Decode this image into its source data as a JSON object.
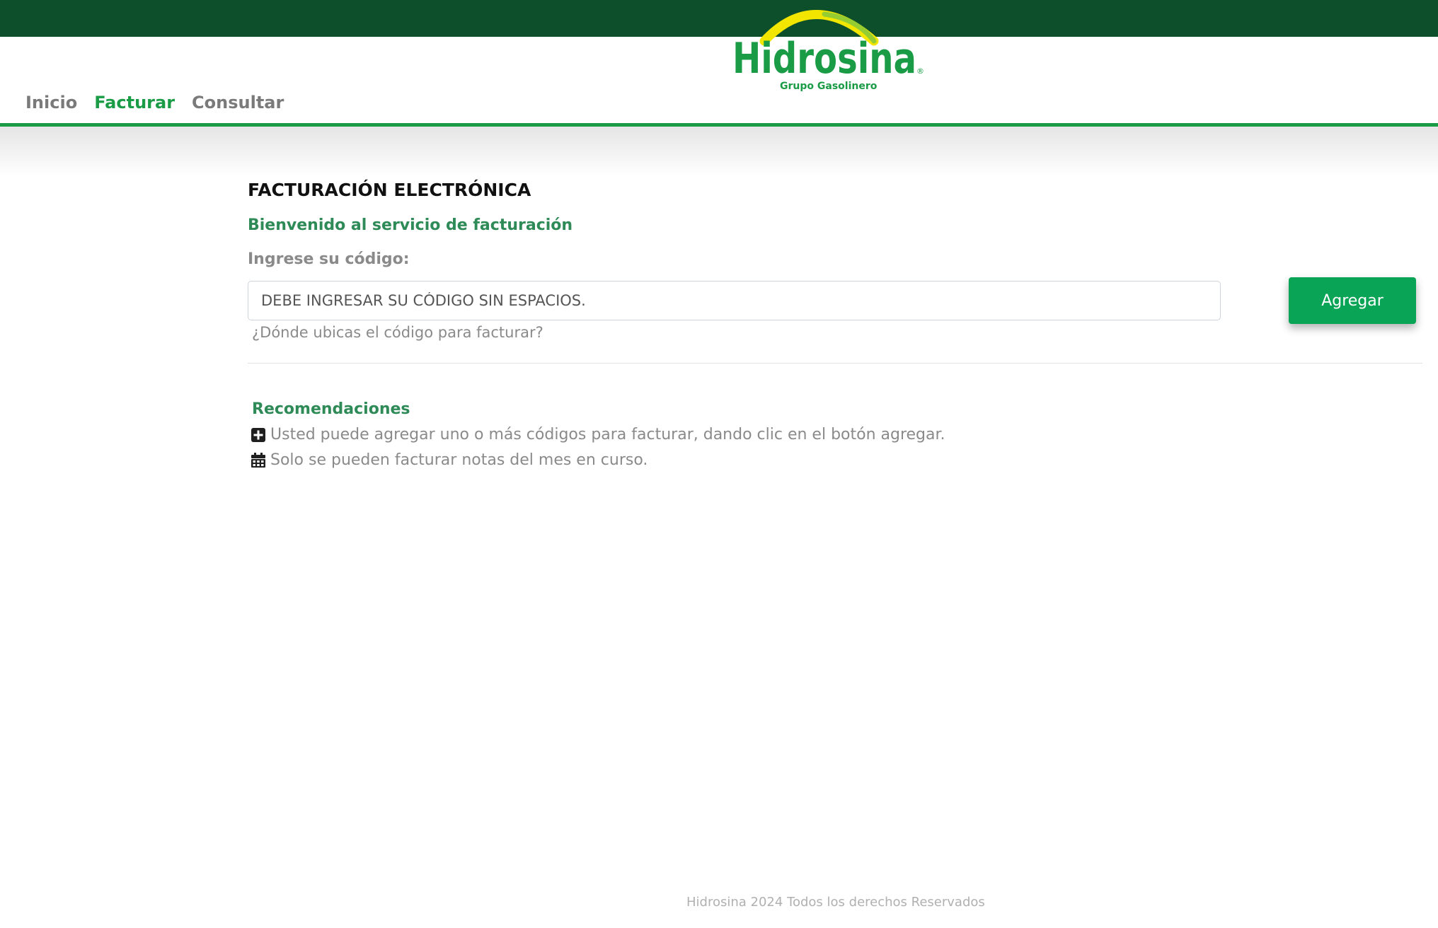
{
  "brand": {
    "name": "Hidrosina",
    "tagline": "Grupo Gasolinero",
    "registered_mark": "®"
  },
  "colors": {
    "top_bar": "#0c4f2a",
    "accent_green": "#1a9b45",
    "button_green": "#0aa456",
    "logo_yellow": "#f2e600"
  },
  "nav": {
    "items": [
      {
        "label": "Inicio",
        "active": false
      },
      {
        "label": "Facturar",
        "active": true
      },
      {
        "label": "Consultar",
        "active": false
      }
    ]
  },
  "main": {
    "title": "FACTURACIÓN ELECTRÓNICA",
    "welcome": "Bienvenido al servicio de facturación",
    "code_label": "Ingrese su código:",
    "code_input": {
      "value": "",
      "placeholder": "DEBE INGRESAR SU CÓDIGO SIN ESPACIOS."
    },
    "help_link": "¿Dónde ubicas el código para facturar?",
    "add_button": "Agregar"
  },
  "recommendations": {
    "title": "Recomendaciones",
    "items": [
      {
        "icon": "plus-square-icon",
        "text": "Usted puede agregar uno o más códigos para facturar, dando clic en el botón agregar."
      },
      {
        "icon": "calendar-icon",
        "text": "Solo se pueden facturar notas del mes en curso."
      }
    ]
  },
  "footer": {
    "text": "Hidrosina 2024 Todos los derechos Reservados"
  }
}
